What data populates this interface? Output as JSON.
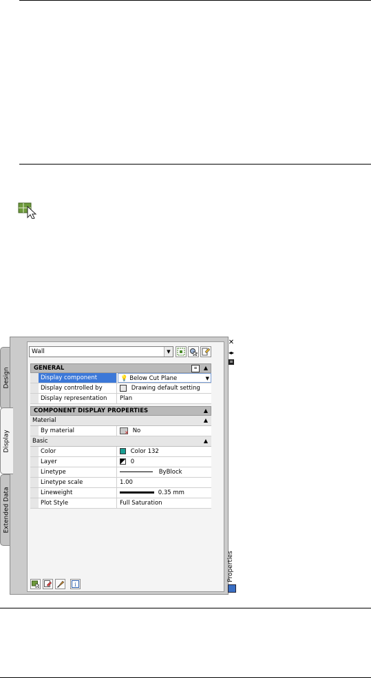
{
  "style_selector": {
    "value": "Wall"
  },
  "tabs": {
    "design": "Design",
    "display": "Display",
    "extended_data": "Extended Data"
  },
  "palette_title": "Properties",
  "general": {
    "header": "GENERAL",
    "rows": [
      {
        "name": "Display component",
        "value": "Below Cut Plane"
      },
      {
        "name": "Display controlled by",
        "value": "Drawing default setting"
      },
      {
        "name": "Display representation",
        "value": "Plan"
      }
    ]
  },
  "component_display": {
    "header": "COMPONENT DISPLAY PROPERTIES",
    "material": {
      "label": "Material",
      "rows": [
        {
          "name": "By material",
          "value": "No"
        }
      ]
    },
    "basic": {
      "label": "Basic",
      "rows": [
        {
          "name": "Color",
          "value": "Color 132"
        },
        {
          "name": "Layer",
          "value": "0"
        },
        {
          "name": "Linetype",
          "value": "ByBlock"
        },
        {
          "name": "Linetype scale",
          "value": "1.00"
        },
        {
          "name": "Lineweight",
          "value": "0.35 mm"
        },
        {
          "name": "Plot Style",
          "value": "Full Saturation"
        }
      ]
    }
  },
  "colors": {
    "color_132": "#1a9e93",
    "selection": "#3c78d8"
  }
}
